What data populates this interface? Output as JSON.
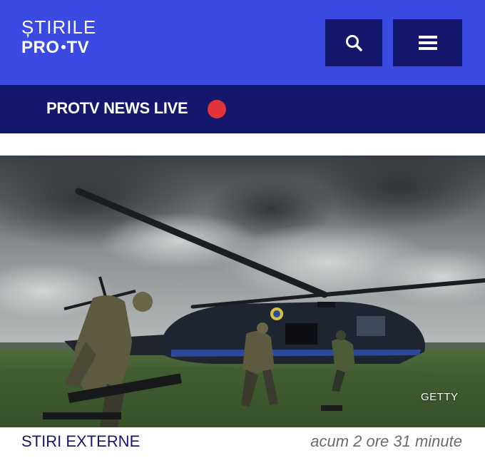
{
  "header": {
    "logo_top": "ȘTIRILE",
    "logo_bottom_left": "PRO",
    "logo_bottom_right": "TV",
    "search_icon": "search-icon",
    "menu_icon": "hamburger-menu-icon",
    "bg_color": "#3b4ae0",
    "button_color": "#14176b"
  },
  "live_bar": {
    "label": "PROTV NEWS LIVE",
    "indicator_color": "#e2343a",
    "bg_color": "#14176b"
  },
  "article": {
    "image_credit": "GETTY",
    "category": "STIRI EXTERNE",
    "time_ago": "acum 2 ore 31 minute"
  }
}
